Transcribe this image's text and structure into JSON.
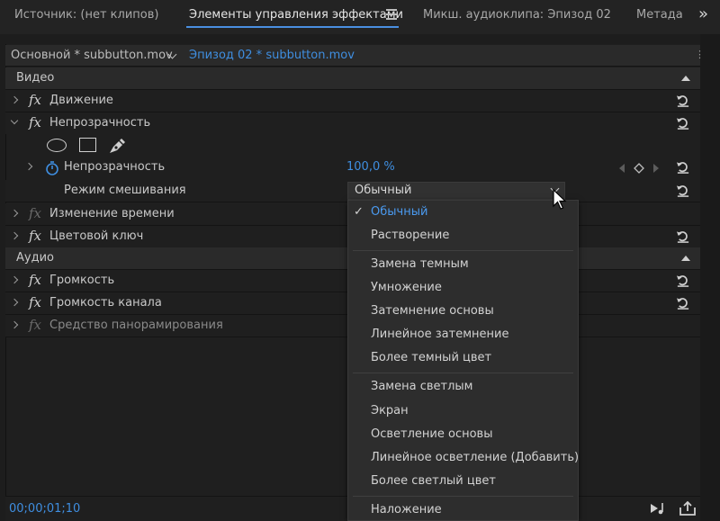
{
  "tabs": [
    {
      "label": "Источник: (нет клипов)",
      "active": false
    },
    {
      "label": "Элементы управления эффектами",
      "active": true
    },
    {
      "label": "Микш. аудиоклипа: Эпизод 02",
      "active": false
    },
    {
      "label": "Метада",
      "active": false
    }
  ],
  "clip_header": {
    "source_clip": "Основной * subbutton.mov",
    "sequence_clip": "Эпизод 02 * subbutton.mov"
  },
  "sections": {
    "video": "Видео",
    "audio": "Аудио"
  },
  "effects": {
    "motion": "Движение",
    "opacity": "Непрозрачность",
    "opacity_param": "Непрозрачность",
    "opacity_value": "100,0 %",
    "blend_mode_label": "Режим смешивания",
    "blend_mode_value": "Обычный",
    "time_remap": "Изменение времени",
    "color_key": "Цветовой ключ",
    "volume": "Громкость",
    "channel_volume": "Громкость канала",
    "panner": "Средство панорамирования"
  },
  "blend_menu": {
    "selected": "Обычный",
    "items": [
      "Обычный",
      "Растворение",
      "Замена темным",
      "Умножение",
      "Затемнение основы",
      "Линейное затемнение",
      "Более темный цвет",
      "Замена светлым",
      "Экран",
      "Осветление основы",
      "Линейное осветление (Добавить)",
      "Более светлый цвет",
      "Наложение"
    ]
  },
  "timecode": "00;00;01;10",
  "colors": {
    "accent": "#3f8ee0",
    "panel_bg": "#1f1f1f",
    "menu_bg": "#2d2d2d"
  }
}
